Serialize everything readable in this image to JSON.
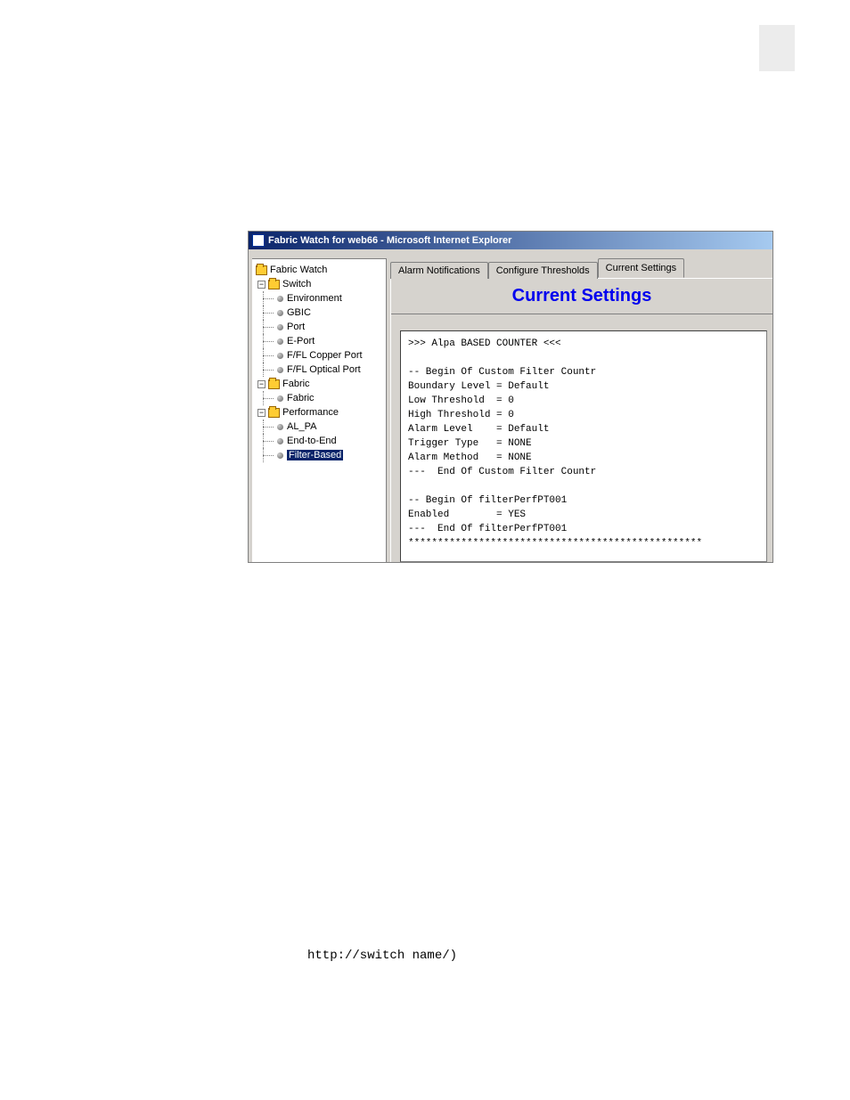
{
  "titlebar": {
    "text": "Fabric Watch for web66 - Microsoft Internet Explorer"
  },
  "tree": {
    "root": "Fabric Watch",
    "switch": {
      "label": "Switch",
      "children": [
        "Environment",
        "GBIC",
        "Port",
        "E-Port",
        "F/FL Copper Port",
        "F/FL Optical Port"
      ]
    },
    "fabric": {
      "label": "Fabric",
      "children": [
        "Fabric"
      ]
    },
    "performance": {
      "label": "Performance",
      "children": [
        "AL_PA",
        "End-to-End",
        "Filter-Based"
      ]
    }
  },
  "tabs": {
    "tab1": "Alarm Notifications",
    "tab2": "Configure Thresholds",
    "tab3": "Current Settings"
  },
  "heading": "Current Settings",
  "output": ">>> Alpa BASED COUNTER <<<\n\n-- Begin Of Custom Filter Countr\nBoundary Level = Default\nLow Threshold  = 0\nHigh Threshold = 0\nAlarm Level    = Default\nTrigger Type   = NONE\nAlarm Method   = NONE\n---  End Of Custom Filter Countr\n\n-- Begin Of filterPerfPT001\nEnabled        = YES\n---  End Of filterPerfPT001\n**************************************************",
  "footer": "http://switch name/)"
}
